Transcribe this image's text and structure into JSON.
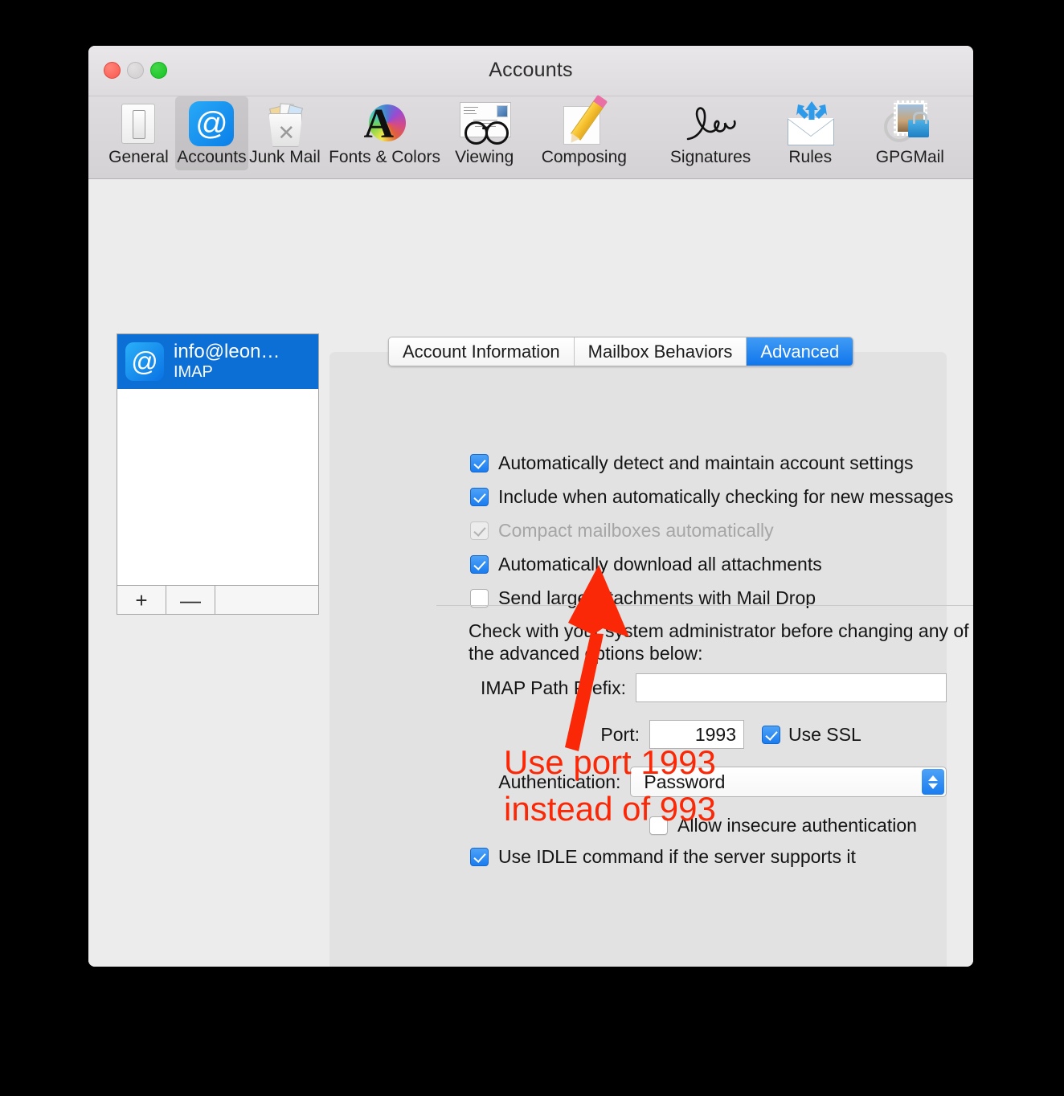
{
  "window": {
    "title": "Accounts",
    "traffic_lights": [
      "close-red",
      "minimize-yellow",
      "zoom-green"
    ]
  },
  "toolbar": {
    "items": [
      {
        "label": "General",
        "icon": "general-switch-icon"
      },
      {
        "label": "Accounts",
        "icon": "at-sign-icon",
        "selected": true
      },
      {
        "label": "Junk Mail",
        "icon": "trash-can-icon"
      },
      {
        "label": "Fonts & Colors",
        "icon": "color-wheel-a-icon"
      },
      {
        "label": "Viewing",
        "icon": "glasses-message-icon"
      },
      {
        "label": "Composing",
        "icon": "pencil-paper-icon"
      },
      {
        "label": "Signatures",
        "icon": "signature-icon"
      },
      {
        "label": "Rules",
        "icon": "arrows-envelope-icon"
      },
      {
        "label": "GPGMail",
        "icon": "stamp-lock-icon"
      }
    ]
  },
  "account_list": {
    "accounts": [
      {
        "name": "info@leon…",
        "type": "IMAP",
        "icon": "at-sign-icon",
        "selected": true
      }
    ],
    "add_label": "+",
    "remove_label": "—"
  },
  "tabs": [
    {
      "label": "Account Information",
      "active": false
    },
    {
      "label": "Mailbox Behaviors",
      "active": false
    },
    {
      "label": "Advanced",
      "active": true
    }
  ],
  "checkboxes": [
    {
      "label": "Automatically detect and maintain account settings",
      "state": "on"
    },
    {
      "label": "Include when automatically checking for new messages",
      "state": "on"
    },
    {
      "label": "Compact mailboxes automatically",
      "state": "disabled-on"
    },
    {
      "label": "Automatically download all attachments",
      "state": "on"
    },
    {
      "label": "Send large attachments with Mail Drop",
      "state": "off"
    }
  ],
  "admin_note": "Check with your system administrator before changing any of the advanced options below:",
  "form": {
    "imap_path_prefix": {
      "label": "IMAP Path Prefix:",
      "value": "",
      "placeholder": ""
    },
    "port": {
      "label": "Port:",
      "value": "1993"
    },
    "use_ssl": {
      "label": "Use SSL",
      "state": "on"
    },
    "authentication": {
      "label": "Authentication:",
      "value": "Password"
    },
    "allow_insecure": {
      "label": "Allow insecure authentication",
      "state": "off"
    },
    "use_idle": {
      "label": "Use IDLE command if the server supports it",
      "state": "on"
    }
  },
  "help": {
    "label": "?"
  },
  "annotation": {
    "color": "#fa2806",
    "line1": "Use port 1993",
    "line2": "instead of 993",
    "arrow": "red-arrow-pointing-to-port-field"
  }
}
